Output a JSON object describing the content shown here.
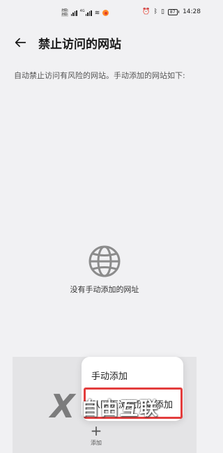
{
  "status_bar": {
    "sim_labels": [
      "HD",
      "HD"
    ],
    "network_label": "4G",
    "battery": "87",
    "time": "14:28",
    "icons": [
      "sim-icon",
      "signal-icon",
      "wifi-icon",
      "notification-icon",
      "alarm-icon",
      "bluetooth-icon",
      "vibrate-icon",
      "battery-icon"
    ]
  },
  "header": {
    "title": "禁止访问的网站",
    "back_icon": "arrow-left-icon"
  },
  "description": "自动禁止访问有风险的网站。手动添加的网站如下:",
  "empty_state": {
    "icon": "globe-icon",
    "text": "没有手动添加的网址"
  },
  "popup_menu": {
    "items": [
      "手动添加",
      "从网页浏览历史添加"
    ]
  },
  "add_button": {
    "icon": "plus-icon",
    "label": "添加"
  },
  "watermark": {
    "text": "自由互联"
  },
  "colors": {
    "highlight": "#e33d3d",
    "background": "#f1f1f3"
  }
}
